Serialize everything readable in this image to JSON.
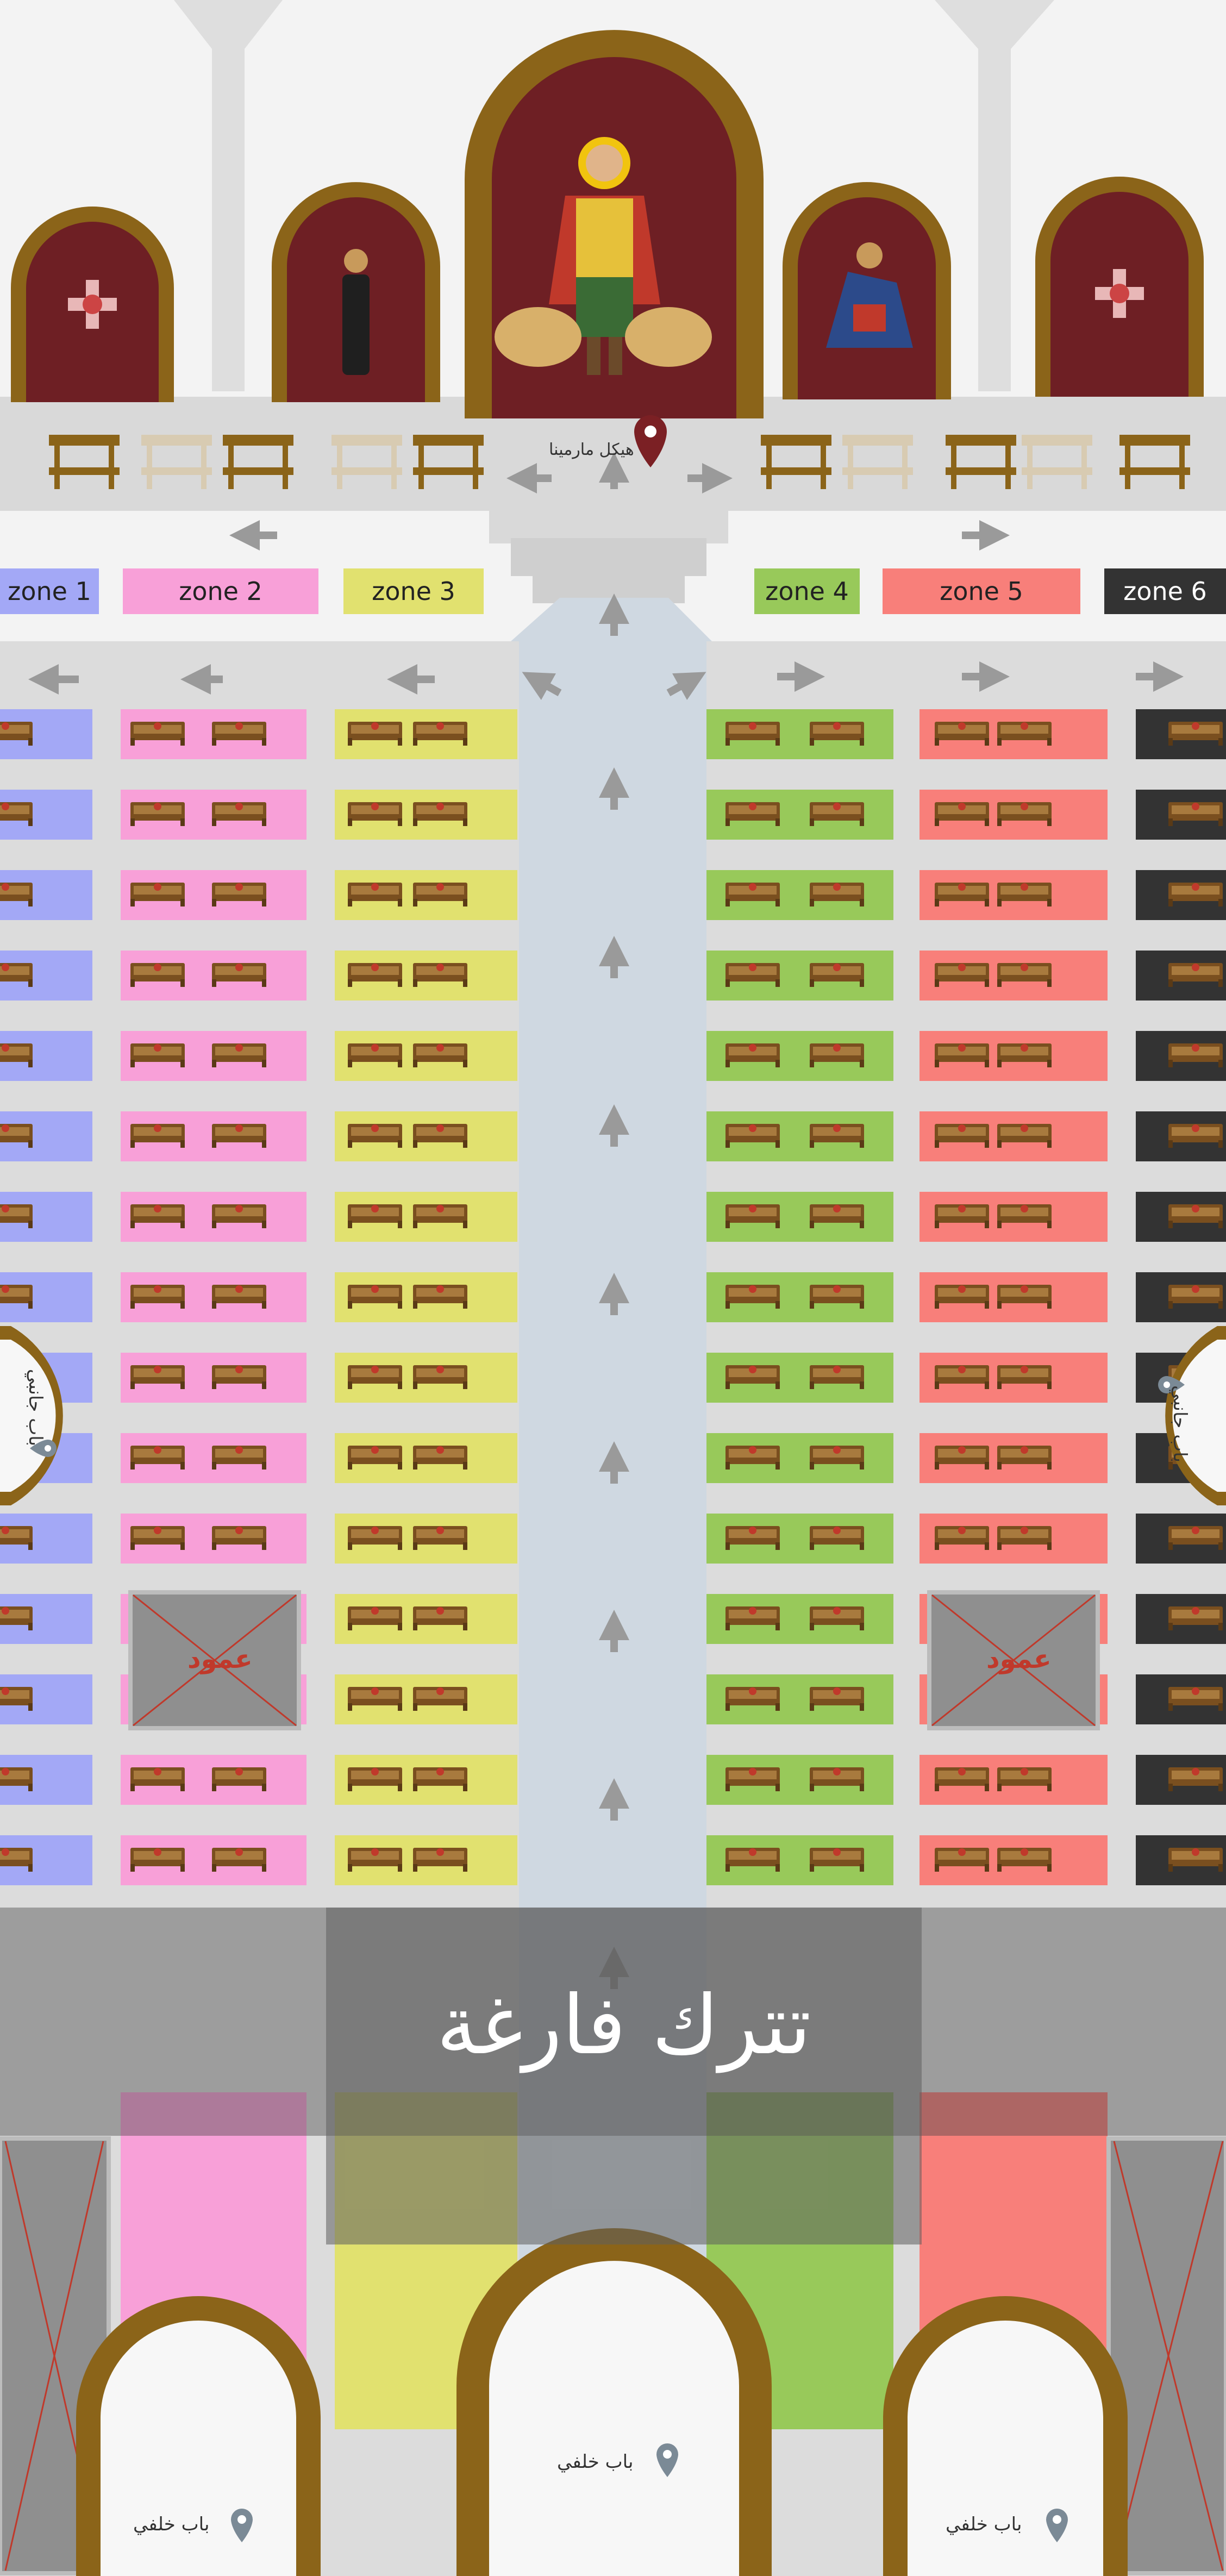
{
  "zones": [
    {
      "label": "zone 1",
      "color": "#a3a8f6"
    },
    {
      "label": "zone 2",
      "color": "#f8a0d8"
    },
    {
      "label": "zone 3",
      "color": "#e1e16f"
    },
    {
      "label": "zone 4",
      "color": "#98c95a"
    },
    {
      "label": "zone 5",
      "color": "#f87f7a"
    },
    {
      "label": "zone 6",
      "color": "#333333"
    }
  ],
  "altar": {
    "label": "هيكل مارمينا"
  },
  "side_doors": {
    "left": "باب جانبي",
    "right": "باب جانبي"
  },
  "back_doors": {
    "left": "باب خلفي",
    "center": "باب خلفي",
    "right": "باب خلفي"
  },
  "pillars": {
    "left": "عمود",
    "right": "عمود"
  },
  "overlay": {
    "text": "تترك فارغة"
  },
  "icons": [
    "location-pin-icon",
    "arrow-icon",
    "pew-icon",
    "saint-icon",
    "coptic-cross-icon"
  ],
  "colors": {
    "arch_gold": "#8b6419",
    "icon_bg": "#6e1f24",
    "aisle": "#cfd8e1",
    "floor": "#dcdcdc",
    "pin_gray": "#7b8a96",
    "pin_red": "#7b2024"
  }
}
